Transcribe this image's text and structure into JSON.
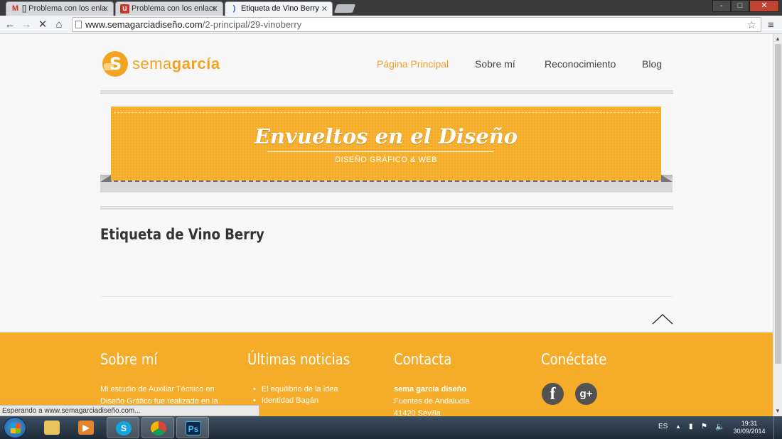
{
  "browser": {
    "tabs": [
      {
        "label": "[] Problema con los enlac",
        "icon": "gmail-icon"
      },
      {
        "label": "Problema con los enlaces",
        "icon": "site-favicon"
      },
      {
        "label": "Etiqueta de Vino Berry",
        "icon": "loading-spinner"
      }
    ],
    "url_host": "www.semagarciadiseño.com",
    "url_path": "/2-principal/29-vinoberry",
    "status_text": "Esperando a www.semagarciadiseño.com...",
    "window_buttons": [
      "-",
      "□",
      "✕"
    ]
  },
  "site": {
    "logo_light": "sema",
    "logo_bold": "garcía",
    "nav": [
      "Página Principal",
      "Sobre mí",
      "Reconocimiento",
      "Blog"
    ],
    "active_nav": "Página Principal",
    "banner_title": "Envueltos en el Diseño",
    "banner_subtitle": "DISEÑO GRÁFICO & WEB",
    "page_heading": "Etiqueta de Vino Berry",
    "accent_color": "#f5ac29"
  },
  "footer": {
    "about_title": "Sobre mí",
    "about_text_1": "Mi estudio de Auxiliar Técnico en",
    "about_text_2": "Diseño Gráfico fue realizado en la",
    "news_title": "Últimas noticias",
    "news_items": [
      "El equilibrio de la idea",
      "Identidad Bagán"
    ],
    "contact_title": "Contacta",
    "contact_name": "sema garcia diseño",
    "contact_line_1": "Fuentes de Andalucía",
    "contact_line_2": "41420 Sevilla",
    "social_title": "Conéctate",
    "social_icons": [
      "facebook-icon",
      "google-plus-icon"
    ]
  },
  "taskbar": {
    "lang": "ES",
    "time": "19:31",
    "date": "30/09/2014",
    "apps": [
      "explorer",
      "media-player",
      "skype",
      "chrome",
      "photoshop"
    ]
  }
}
